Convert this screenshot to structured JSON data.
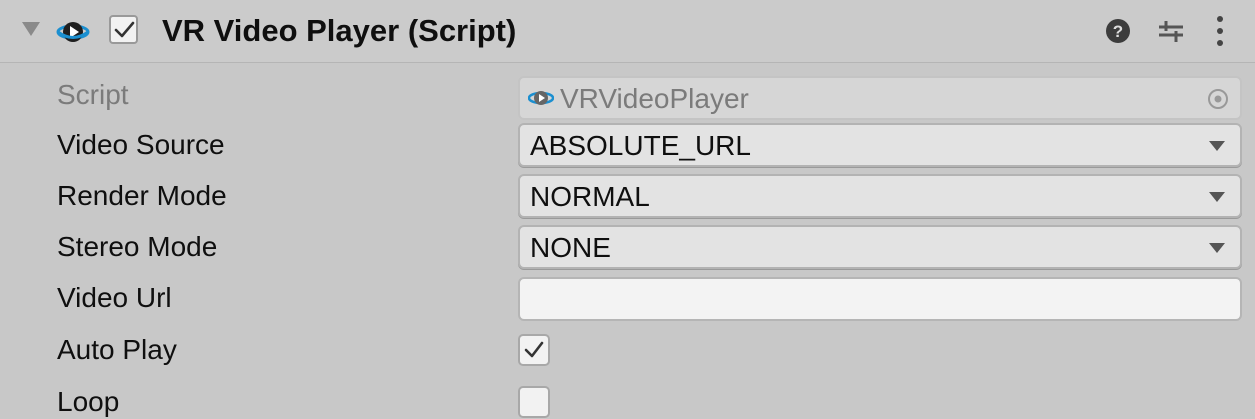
{
  "component": {
    "title": "VR Video Player (Script)",
    "enabled": true,
    "icon": "vr-video-player-script-icon",
    "header_actions": [
      "help-icon",
      "preset-icon",
      "context-menu-icon"
    ]
  },
  "properties": {
    "script": {
      "label": "Script",
      "value": "VRVideoPlayer"
    },
    "video_source": {
      "label": "Video Source",
      "value": "ABSOLUTE_URL"
    },
    "render_mode": {
      "label": "Render Mode",
      "value": "NORMAL"
    },
    "stereo_mode": {
      "label": "Stereo Mode",
      "value": "NONE"
    },
    "video_url": {
      "label": "Video Url",
      "value": ""
    },
    "auto_play": {
      "label": "Auto Play",
      "checked": true
    },
    "loop": {
      "label": "Loop",
      "checked": false
    }
  },
  "colors": {
    "panel_background": "#c8c8c8",
    "icon_blue": "#1b8fd0",
    "text": "#0f0f0f",
    "disabled_text": "#7b7b7b"
  }
}
